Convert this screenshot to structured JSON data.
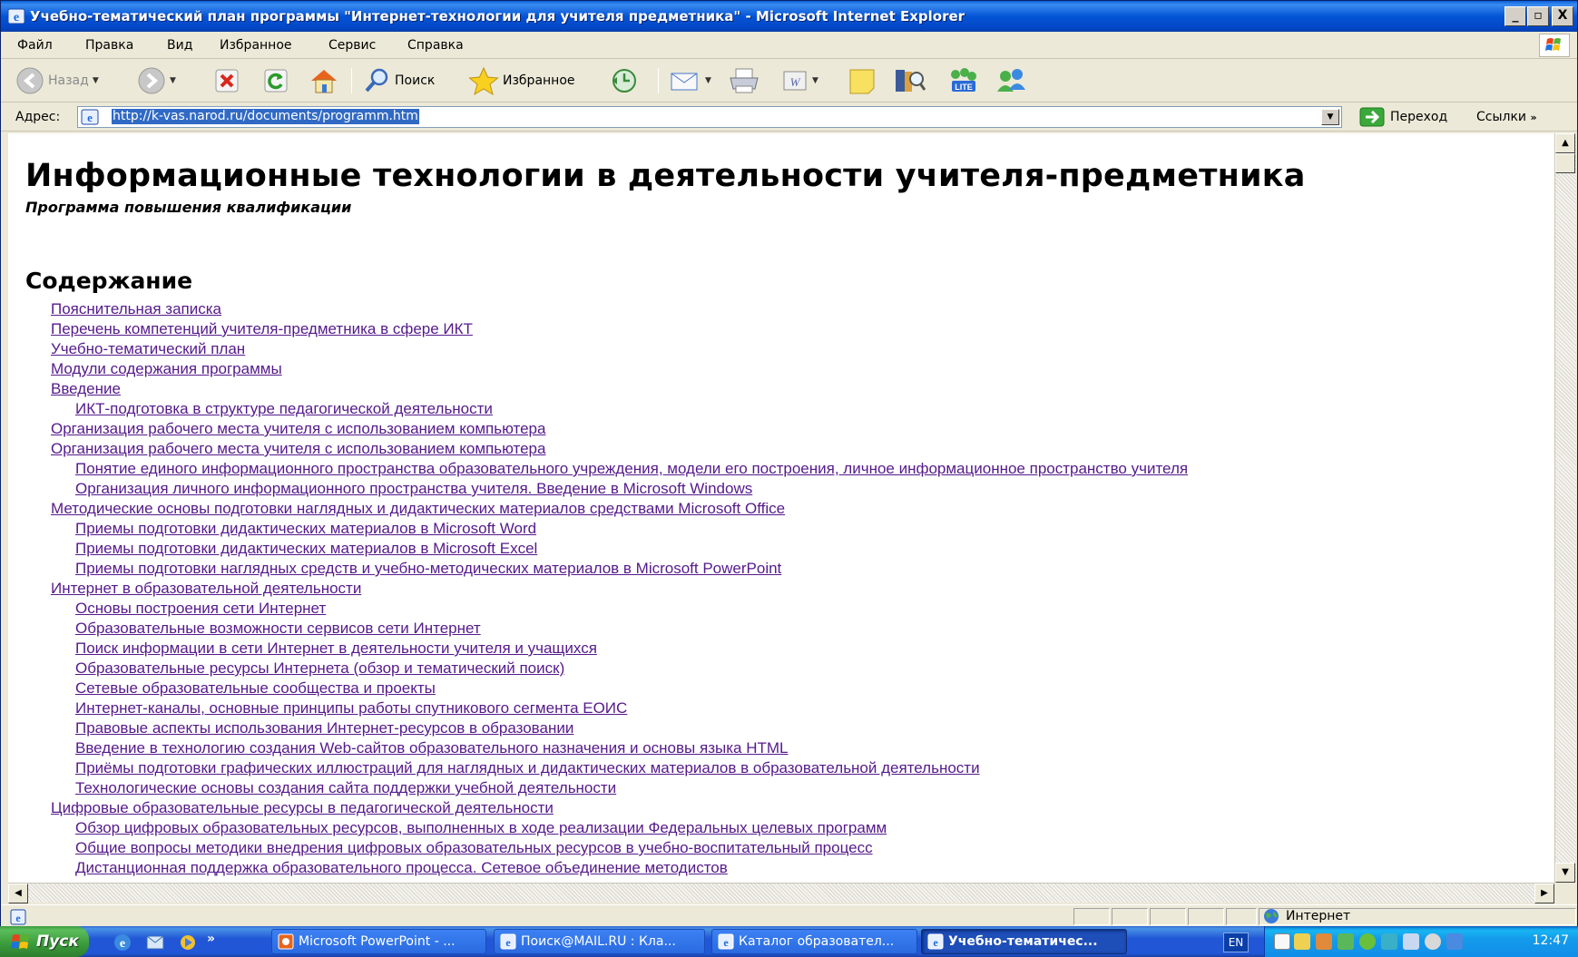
{
  "window": {
    "title": "Учебно-тематический план программы \"Интернет-технологии для учителя предметника\" - Microsoft Internet Explorer",
    "minimize": "_",
    "maximize": "▫",
    "close": "X"
  },
  "menu": [
    "Файл",
    "Правка",
    "Вид",
    "Избранное",
    "Сервис",
    "Справка"
  ],
  "toolbar": {
    "back": "Назад",
    "search": "Поиск",
    "favorites": "Избранное"
  },
  "address": {
    "label": "Адрес:",
    "url": "http://k-vas.narod.ru/documents/programm.htm",
    "go": "Переход",
    "links": "Ссылки"
  },
  "page": {
    "heading": "Информационные технологии в деятельности учителя-предметника",
    "subtitle": "Программа повышения квалификации",
    "toc_heading": "Содержание",
    "toc": [
      {
        "level": 1,
        "text": "Пояснительная записка"
      },
      {
        "level": 1,
        "text": "Перечень компетенций учителя-предметника в сфере ИКТ"
      },
      {
        "level": 1,
        "text": "Учебно-тематический план"
      },
      {
        "level": 1,
        "text": "Модули содержания программы"
      },
      {
        "level": 1,
        "text": "Введение"
      },
      {
        "level": 2,
        "text": "ИКТ-подготовка в структуре педагогической деятельности"
      },
      {
        "level": 1,
        "text": "Организация рабочего места учителя с использованием компьютера"
      },
      {
        "level": 1,
        "text": "Организация рабочего места учителя с использованием компьютера"
      },
      {
        "level": 2,
        "text": "Понятие единого информационного пространства образовательного учреждения, модели его построения, личное информационное пространство учителя"
      },
      {
        "level": 2,
        "text": "Организация личного информационного пространства учителя.  Введение в Microsoft Windows"
      },
      {
        "level": 1,
        "text": "Методические основы подготовки наглядных и дидактических материалов средствами Microsoft Office"
      },
      {
        "level": 2,
        "text": "Приемы подготовки дидактических материалов в Microsoft Word"
      },
      {
        "level": 2,
        "text": "Приемы подготовки дидактических материалов в Microsoft Excel"
      },
      {
        "level": 2,
        "text": "Приемы подготовки наглядных средств и учебно-методических материалов в Microsoft PowerPoint"
      },
      {
        "level": 1,
        "text": "Интернет в образовательной деятельности"
      },
      {
        "level": 2,
        "text": "Основы построения сети Интернет"
      },
      {
        "level": 2,
        "text": "Образовательные возможности сервисов сети Интернет"
      },
      {
        "level": 2,
        "text": "Поиск информации в сети Интернет в деятельности учителя и учащихся"
      },
      {
        "level": 2,
        "text": "Образовательные ресурсы Интернета (обзор и тематический поиск)"
      },
      {
        "level": 2,
        "text": "Сетевые образовательные сообщества и проекты"
      },
      {
        "level": 2,
        "text": "Интернет-каналы, основные принципы работы спутникового сегмента ЕОИС"
      },
      {
        "level": 2,
        "text": "Правовые аспекты использования Интернет-ресурсов в образовании"
      },
      {
        "level": 2,
        "text": "Введение в технологию создания Web-сайтов образовательного назначения и основы языка HTML"
      },
      {
        "level": 2,
        "text": "Приёмы подготовки графических иллюстраций для наглядных и дидактических материалов в образовательной деятельности"
      },
      {
        "level": 2,
        "text": "Технологические основы создания сайта поддержки учебной деятельности"
      },
      {
        "level": 1,
        "text": "Цифровые образовательные ресурсы в педагогической деятельности"
      },
      {
        "level": 2,
        "text": "Обзор цифровых образовательных ресурсов, выполненных в ходе реализации Федеральных целевых программ"
      },
      {
        "level": 2,
        "text": "Общие вопросы методики внедрения цифровых образовательных ресурсов в учебно-воспитательный процесс"
      },
      {
        "level": 2,
        "text": "Дистанционная поддержка образовательного процесса. Сетевое объединение методистов"
      }
    ]
  },
  "status": {
    "zone": "Интернет"
  },
  "taskbar": {
    "start": "Пуск",
    "quick_more": "»",
    "tasks": [
      {
        "label": "Microsoft PowerPoint - ...",
        "active": false
      },
      {
        "label": "Поиск@MAIL.RU : Кла...",
        "active": false
      },
      {
        "label": "Каталог образовател...",
        "active": false
      },
      {
        "label": "Учебно-тематичес...",
        "active": true
      }
    ],
    "lang": "EN",
    "clock": "12:47"
  },
  "colors": {
    "titlebar": "#0454d6",
    "link_visited": "#551a8b",
    "chrome": "#ece9d8",
    "taskbar": "#2157d7",
    "start": "#3a9a3a"
  }
}
